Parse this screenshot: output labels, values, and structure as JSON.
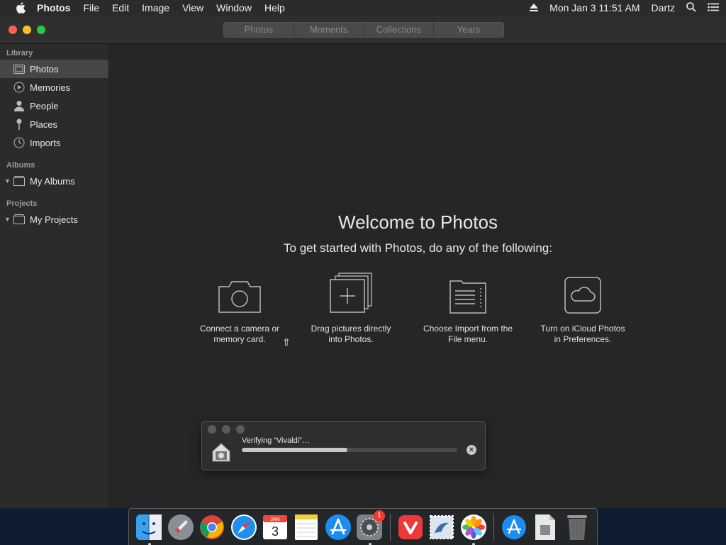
{
  "menubar": {
    "app_name": "Photos",
    "items": [
      "File",
      "Edit",
      "Image",
      "View",
      "Window",
      "Help"
    ],
    "clock": "Mon Jan 3  11:51 AM",
    "user": "Dartz"
  },
  "toolbar": {
    "tabs": [
      "Photos",
      "Moments",
      "Collections",
      "Years"
    ]
  },
  "sidebar": {
    "library_header": "Library",
    "library_items": [
      {
        "label": "Photos",
        "icon": "photos-icon",
        "selected": true
      },
      {
        "label": "Memories",
        "icon": "memories-icon"
      },
      {
        "label": "People",
        "icon": "people-icon"
      },
      {
        "label": "Places",
        "icon": "places-pin-icon"
      },
      {
        "label": "Imports",
        "icon": "imports-clock-icon"
      }
    ],
    "albums_header": "Albums",
    "albums_item": "My Albums",
    "projects_header": "Projects",
    "projects_item": "My Projects"
  },
  "welcome": {
    "title": "Welcome to Photos",
    "subtitle": "To get started with Photos, do any of the following:",
    "options": [
      {
        "icon": "camera-icon",
        "text_line1": "Connect a camera or",
        "text_line2": "memory card."
      },
      {
        "icon": "add-stack-icon",
        "text_line1": "Drag pictures directly",
        "text_line2": "into Photos."
      },
      {
        "icon": "import-list-icon",
        "text_line1": "Choose Import from the",
        "text_line2": "File menu."
      },
      {
        "icon": "icloud-icon",
        "text_line1": "Turn on iCloud Photos",
        "text_line2": "in Preferences."
      }
    ]
  },
  "progress": {
    "label": "Verifying “Vivaldi”…",
    "progress_fraction": 0.49
  },
  "dock": {
    "apps": [
      "Finder",
      "Launchpad",
      "Chrome",
      "Safari",
      "Calendar",
      "Notes",
      "App Store",
      "System Preferences",
      "Vivaldi",
      "Mail",
      "Photos",
      "App Store Downloads",
      "Document",
      "Trash"
    ],
    "calendar_month": "JAN",
    "calendar_day": "3",
    "sysprefs_badge": "1"
  },
  "colors": {
    "accent_red": "#fe5f57",
    "accent_yellow": "#febc2e",
    "accent_green": "#28c840"
  }
}
